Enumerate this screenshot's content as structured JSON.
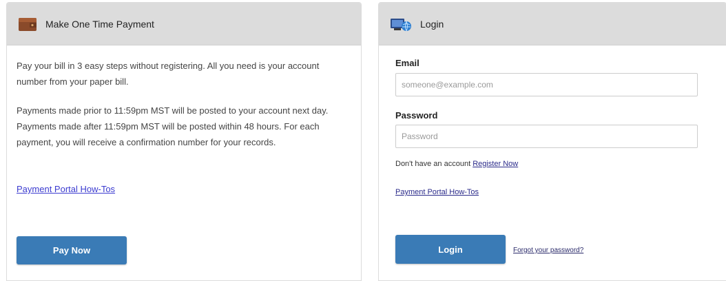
{
  "payment_panel": {
    "title": "Make One Time Payment",
    "icon": "wallet-icon",
    "paragraph1": "Pay your bill in 3 easy steps without registering. All you need is your account number from your paper bill.",
    "paragraph2": "Payments made prior to 11:59pm MST will be posted to your account next day. Payments made after 11:59pm MST will be posted within 48 hours. For each payment, you will receive a confirmation number for your records.",
    "howto_link": "Payment Portal How-Tos",
    "pay_button": "Pay Now"
  },
  "login_panel": {
    "title": "Login",
    "icon": "globe-computer-icon",
    "email_label": "Email",
    "email_placeholder": "someone@example.com",
    "email_value": "",
    "password_label": "Password",
    "password_placeholder": "Password",
    "password_value": "",
    "no_account_text": "Don't have an account",
    "register_link": "Register Now",
    "howto_link": "Payment Portal How-Tos",
    "login_button": "Login",
    "forgot_link": "Forgot your password?"
  },
  "colors": {
    "header_bg": "#dcdcdc",
    "button_bg": "#3a7bb6",
    "link": "#3b3bd0"
  }
}
